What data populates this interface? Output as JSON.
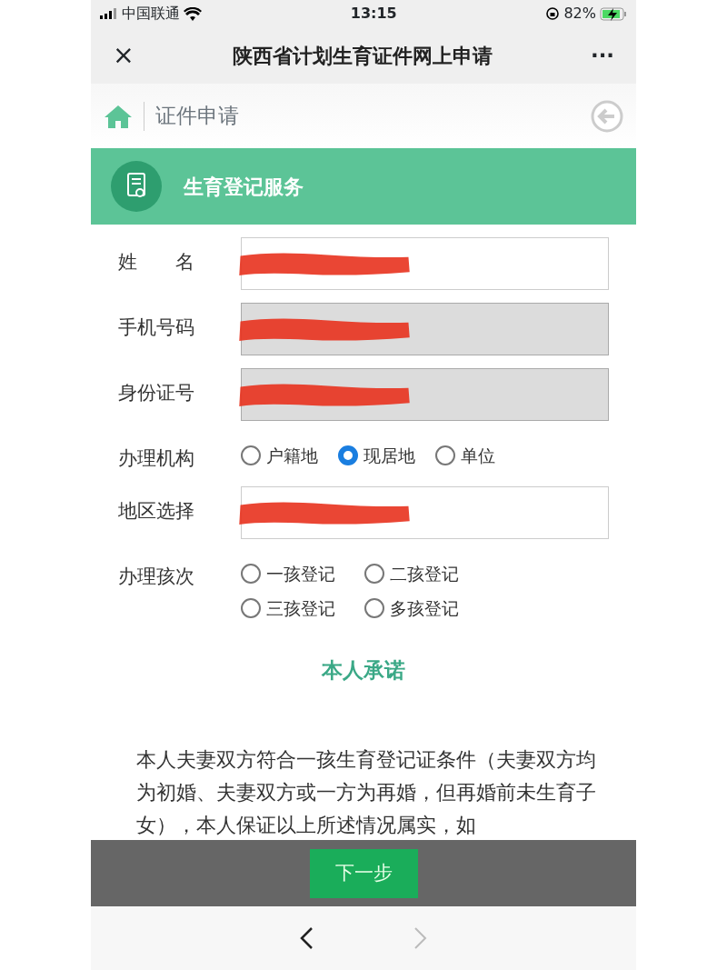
{
  "status_bar": {
    "carrier": "中国联通",
    "time": "13:15",
    "battery": "82%",
    "charging": true
  },
  "title_bar": {
    "close": "×",
    "title": "陕西省计划生育证件网上申请",
    "more": "···"
  },
  "breadcrumb": {
    "label": "证件申请"
  },
  "section": {
    "title": "生育登记服务"
  },
  "fields": [
    {
      "kind": "input",
      "label": "姓　　名",
      "disabled": false,
      "redacted": true
    },
    {
      "kind": "input",
      "label": "手机号码",
      "disabled": true,
      "redacted": true
    },
    {
      "kind": "input",
      "label": "身份证号",
      "disabled": true,
      "redacted": true
    },
    {
      "kind": "radio",
      "label": "办理机构",
      "options": [
        {
          "label": "户籍地",
          "selected": false
        },
        {
          "label": "现居地",
          "selected": true
        },
        {
          "label": "单位",
          "selected": false
        }
      ]
    },
    {
      "kind": "input",
      "label": "地区选择",
      "disabled": false,
      "redacted": true
    },
    {
      "kind": "radio",
      "label": "办理孩次",
      "options": [
        {
          "label": "一孩登记",
          "selected": false
        },
        {
          "label": "二孩登记",
          "selected": false
        },
        {
          "label": "三孩登记",
          "selected": false
        },
        {
          "label": "多孩登记",
          "selected": false
        }
      ]
    }
  ],
  "pledge": {
    "title": "本人承诺",
    "text": "本人夫妻双方符合一孩生育登记证条件（夫妻双方均为初婚、夫妻双方或一方为再婚，但再婚前未生育子女），本人保证以上所述情况属实，如"
  },
  "footer": {
    "button": "下一步"
  }
}
